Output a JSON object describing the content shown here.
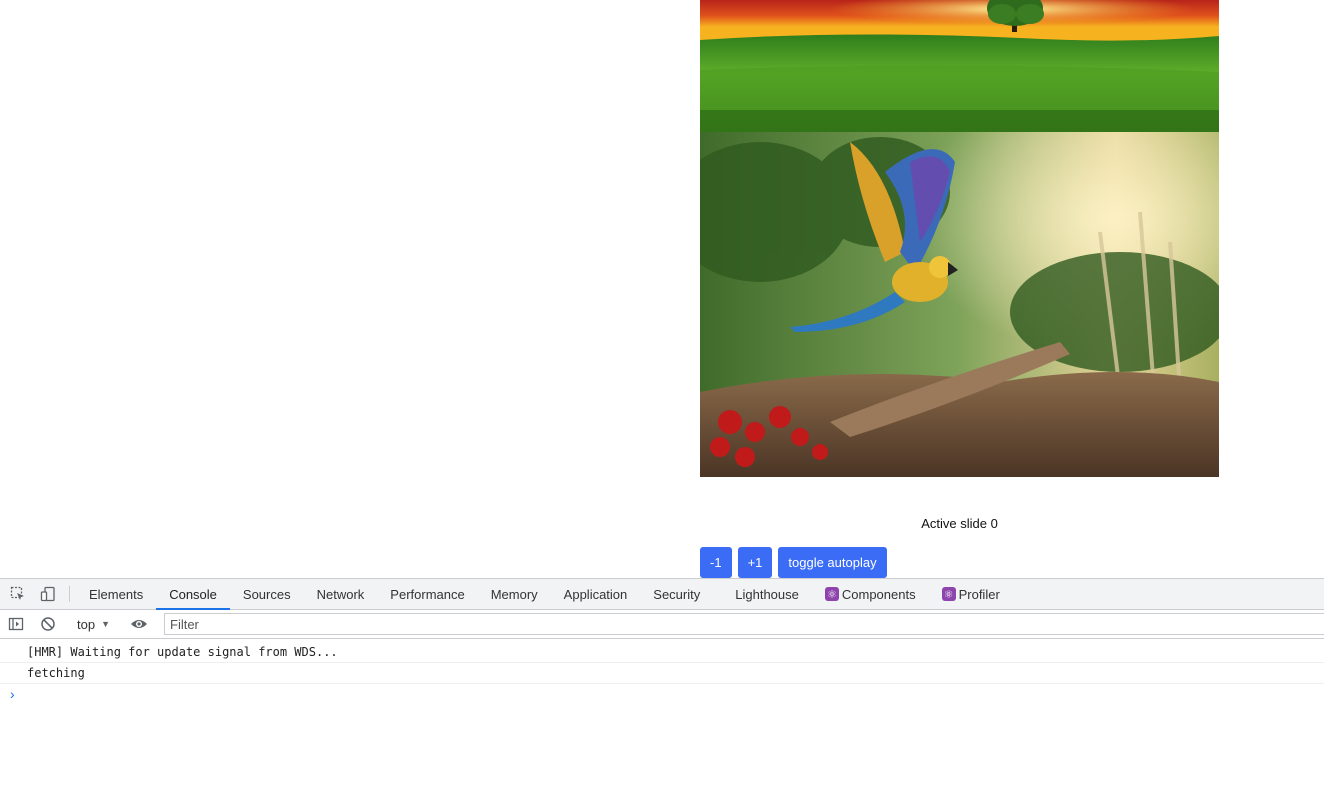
{
  "page": {
    "active_slide_text": "Active slide 0",
    "buttons": {
      "prev": "-1",
      "next": "+1",
      "toggle": "toggle autoplay"
    },
    "slides": [
      {
        "description": "sunset-tree-field-image"
      },
      {
        "description": "macaw-parrot-forest-image"
      }
    ],
    "accent_color": "#3b6cf6"
  },
  "devtools": {
    "tabs": [
      {
        "label": "Elements"
      },
      {
        "label": "Console"
      },
      {
        "label": "Sources"
      },
      {
        "label": "Network"
      },
      {
        "label": "Performance"
      },
      {
        "label": "Memory"
      },
      {
        "label": "Application"
      },
      {
        "label": "Security"
      },
      {
        "label": "Lighthouse"
      },
      {
        "label": "Components"
      },
      {
        "label": "Profiler"
      }
    ],
    "active_tab": "Console",
    "toolbar": {
      "context": "top",
      "filter_placeholder": "Filter"
    },
    "console_lines": [
      "[HMR] Waiting for update signal from WDS...",
      "fetching"
    ],
    "prompt_symbol": "›"
  }
}
